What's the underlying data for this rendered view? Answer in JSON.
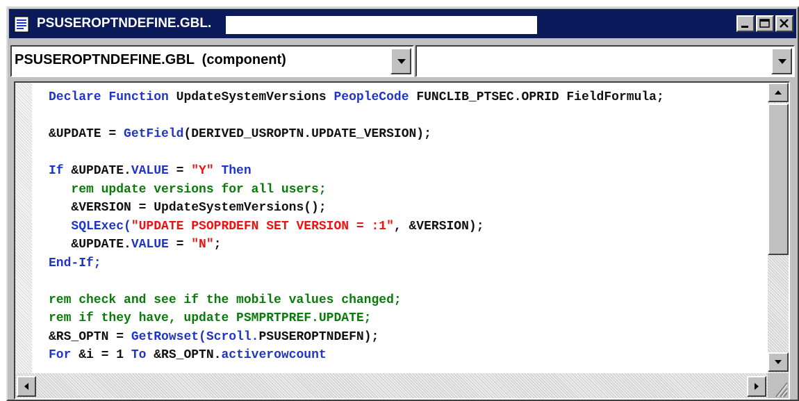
{
  "window": {
    "title": "PSUSEROPTNDEFINE.GBL."
  },
  "toolbar": {
    "object_select_value": "PSUSEROPTNDEFINE.GBL  (component)",
    "event_select_value": ""
  },
  "editor": {
    "lines": [
      [
        {
          "t": "Declare Function ",
          "c": "kw"
        },
        {
          "t": "UpdateSystemVersions ",
          "c": "txt"
        },
        {
          "t": "PeopleCode ",
          "c": "kw"
        },
        {
          "t": "FUNCLIB_PTSEC.OPRID FieldFormula;",
          "c": "txt"
        }
      ],
      [],
      [
        {
          "t": "&UPDATE = ",
          "c": "txt"
        },
        {
          "t": "GetField",
          "c": "kw"
        },
        {
          "t": "(DERIVED_USROPTN.UPDATE_VERSION);",
          "c": "txt"
        }
      ],
      [],
      [
        {
          "t": "If ",
          "c": "kw"
        },
        {
          "t": "&UPDATE.",
          "c": "txt"
        },
        {
          "t": "VALUE",
          "c": "kw"
        },
        {
          "t": " = ",
          "c": "txt"
        },
        {
          "t": "\"Y\"",
          "c": "str"
        },
        {
          "t": " Then",
          "c": "kw"
        }
      ],
      [
        {
          "t": "   rem update versions for all users;",
          "c": "cmt"
        }
      ],
      [
        {
          "t": "   &VERSION = UpdateSystemVersions();",
          "c": "txt"
        }
      ],
      [
        {
          "t": "   ",
          "c": "txt"
        },
        {
          "t": "SQLExec(",
          "c": "kw"
        },
        {
          "t": "\"UPDATE PSOPRDEFN SET VERSION = :1\"",
          "c": "str"
        },
        {
          "t": ", &VERSION);",
          "c": "txt"
        }
      ],
      [
        {
          "t": "   &UPDATE.",
          "c": "txt"
        },
        {
          "t": "VALUE",
          "c": "kw"
        },
        {
          "t": " = ",
          "c": "txt"
        },
        {
          "t": "\"N\"",
          "c": "str"
        },
        {
          "t": ";",
          "c": "txt"
        }
      ],
      [
        {
          "t": "End-If;",
          "c": "kw"
        }
      ],
      [],
      [
        {
          "t": "rem check and see if the mobile values changed;",
          "c": "cmt"
        }
      ],
      [
        {
          "t": "rem if they have, update PSMPRTPREF.UPDATE;",
          "c": "cmt"
        }
      ],
      [
        {
          "t": "&RS_OPTN = ",
          "c": "txt"
        },
        {
          "t": "GetRowset(Scroll.",
          "c": "kw"
        },
        {
          "t": "PSUSEROPTNDEFN);",
          "c": "txt"
        }
      ],
      [
        {
          "t": "For ",
          "c": "kw"
        },
        {
          "t": "&i = 1 ",
          "c": "txt"
        },
        {
          "t": "To ",
          "c": "kw"
        },
        {
          "t": "&RS_OPTN.",
          "c": "txt"
        },
        {
          "t": "activerowcount",
          "c": "kw"
        }
      ]
    ]
  },
  "icons": {
    "app": "document-icon",
    "minimize": "minimize-icon",
    "maximize": "maximize-icon",
    "close": "close-icon",
    "dropdown": "chevron-down-icon",
    "scroll_up": "arrow-up-icon",
    "scroll_down": "arrow-down-icon",
    "scroll_left": "arrow-left-icon",
    "scroll_right": "arrow-right-icon"
  },
  "colors": {
    "titlebar": "#0a1a5a",
    "keyword": "#1f35c8",
    "string": "#ee1111",
    "comment": "#0a7a0a"
  }
}
